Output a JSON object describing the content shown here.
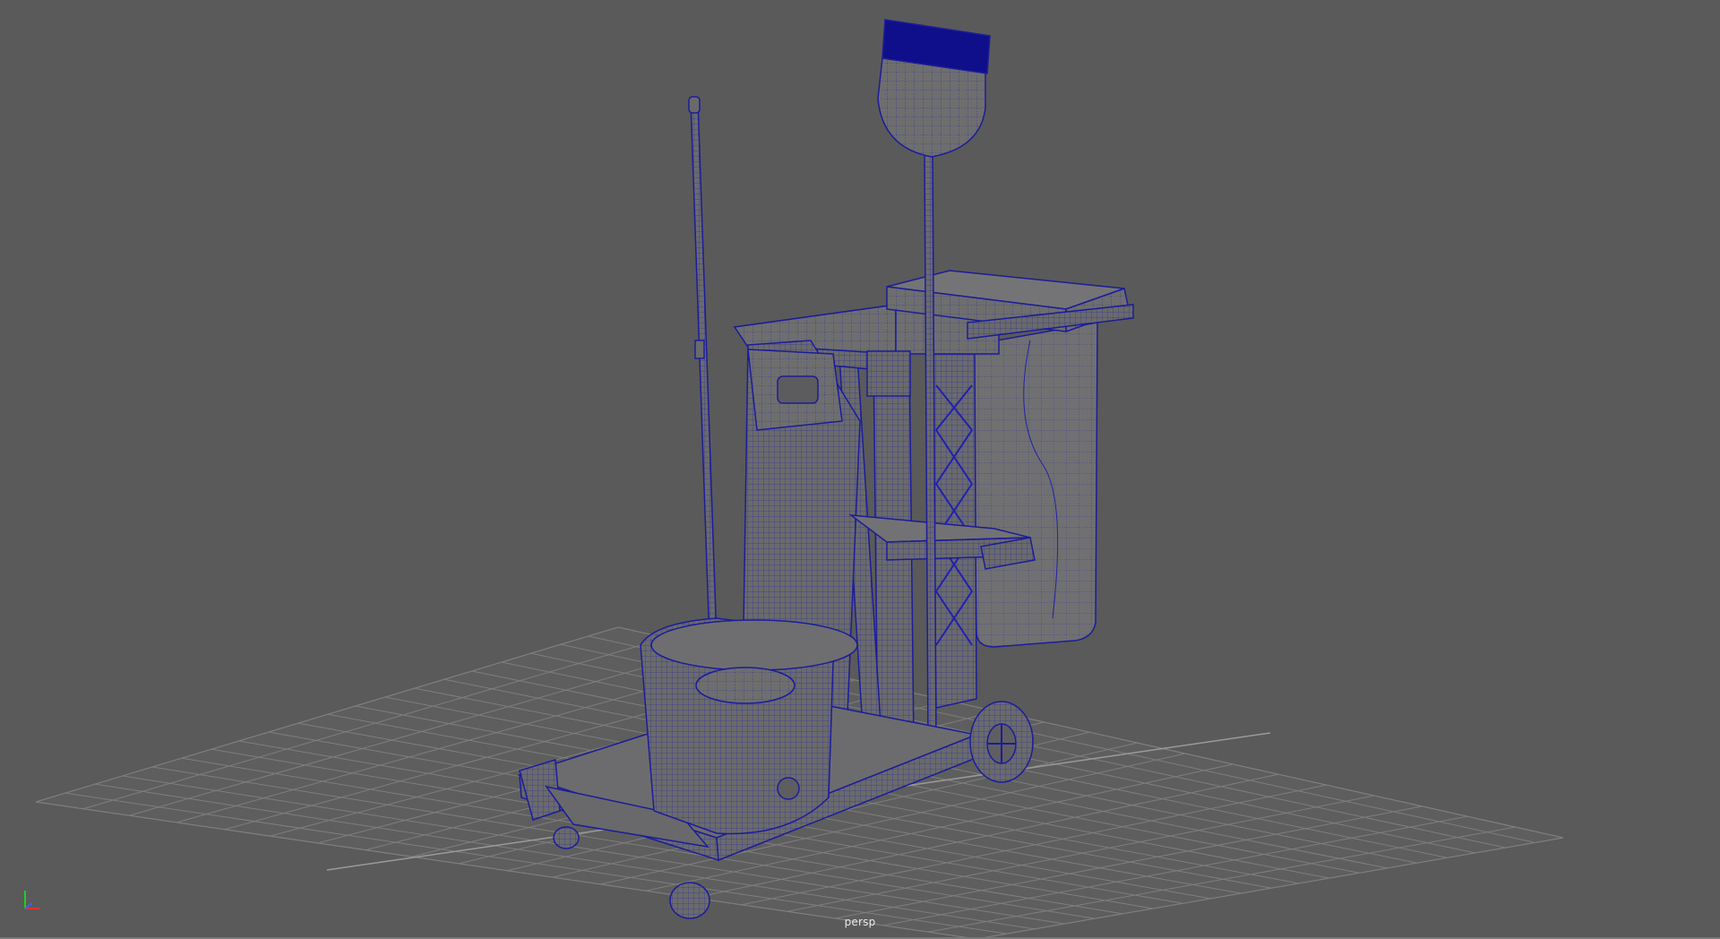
{
  "viewport": {
    "camera_label": "persp",
    "background_color": "#5a5a5a",
    "grid_color": "#7e7e7e",
    "wireframe_color": "#1f1f9e",
    "surface_color": "#6f6f70"
  },
  "model": {
    "object": "janitor-cart",
    "components": [
      "mop",
      "broom",
      "bucket",
      "trash-bag",
      "wheels",
      "frame",
      "shelf",
      "handle"
    ]
  },
  "axis_gizmo": {
    "icon": "axis-gizmo-icon",
    "colors": {
      "x": "#d33",
      "y": "#2c2",
      "z": "#36f"
    }
  }
}
